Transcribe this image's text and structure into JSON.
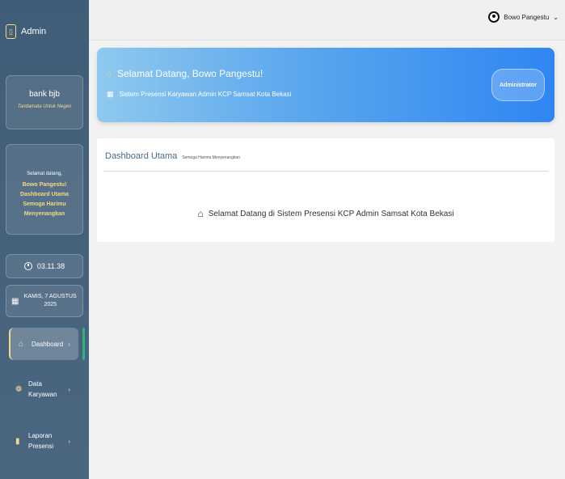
{
  "sidebar": {
    "brand": {
      "label": "Admin",
      "icon": "badge-icon"
    },
    "bank": {
      "name": "bank bjb",
      "tagline": "Tandamata Untuk Negeri"
    },
    "welcome": {
      "greeting": "Selamat datang,",
      "message": "Bowo Pangestu! Dashboard Utama Semoga Harimu Menyenangkan"
    },
    "time": {
      "value": "03.11.38",
      "icon": "clock-icon"
    },
    "date": {
      "value": "KAMIS, 7 AGUSTUS 2025",
      "icon": "calendar-icon"
    },
    "items": [
      {
        "label": "Dashboard",
        "icon": "home-icon",
        "active": true
      },
      {
        "label": "Data Karyawan",
        "icon": "users-icon",
        "active": false
      },
      {
        "label": "Laporan Presensi",
        "icon": "document-icon",
        "active": false
      }
    ]
  },
  "header": {
    "user_name": "Bowo Pangestu",
    "user_icon": "user-circle-icon"
  },
  "hero": {
    "title": "Selamat Datang, Bowo Pangestu!",
    "subtitle": "Sistem Presensi Karyawan Admin KCP Samsat Kota Bekasi",
    "role": "Administrator"
  },
  "main": {
    "title": "Dashboard Utama",
    "subtitle": "Semoga Harimu Menyenangkan",
    "message": "Selamat Datang di Sistem Presensi KCP Admin Samsat Kota Bekasi"
  },
  "colors": {
    "sidebar": "#435f7a",
    "accent_gold": "#f3d98a",
    "active_indicator": "#2fb37d",
    "hero_start": "#8fc9ee",
    "hero_end": "#2f86f2",
    "panel_title": "#4c6a86"
  }
}
